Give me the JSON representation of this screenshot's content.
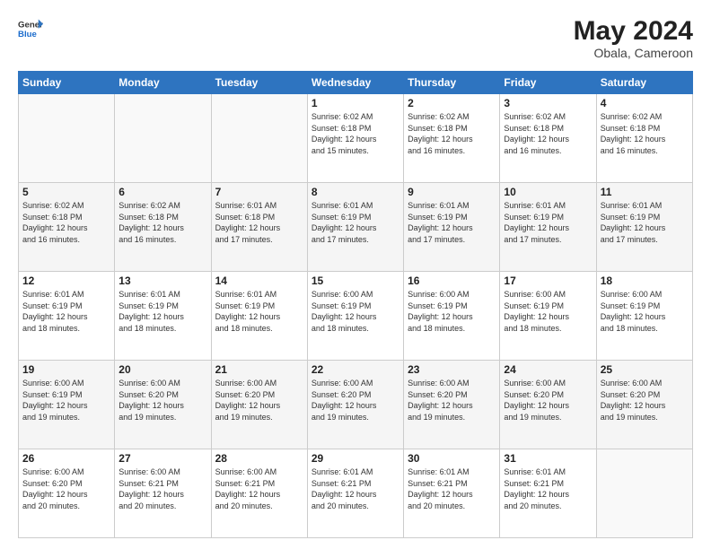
{
  "header": {
    "logo_general": "General",
    "logo_blue": "Blue",
    "month_year": "May 2024",
    "location": "Obala, Cameroon"
  },
  "days_of_week": [
    "Sunday",
    "Monday",
    "Tuesday",
    "Wednesday",
    "Thursday",
    "Friday",
    "Saturday"
  ],
  "weeks": [
    [
      {
        "day": "",
        "info": ""
      },
      {
        "day": "",
        "info": ""
      },
      {
        "day": "",
        "info": ""
      },
      {
        "day": "1",
        "info": "Sunrise: 6:02 AM\nSunset: 6:18 PM\nDaylight: 12 hours\nand 15 minutes."
      },
      {
        "day": "2",
        "info": "Sunrise: 6:02 AM\nSunset: 6:18 PM\nDaylight: 12 hours\nand 16 minutes."
      },
      {
        "day": "3",
        "info": "Sunrise: 6:02 AM\nSunset: 6:18 PM\nDaylight: 12 hours\nand 16 minutes."
      },
      {
        "day": "4",
        "info": "Sunrise: 6:02 AM\nSunset: 6:18 PM\nDaylight: 12 hours\nand 16 minutes."
      }
    ],
    [
      {
        "day": "5",
        "info": "Sunrise: 6:02 AM\nSunset: 6:18 PM\nDaylight: 12 hours\nand 16 minutes."
      },
      {
        "day": "6",
        "info": "Sunrise: 6:02 AM\nSunset: 6:18 PM\nDaylight: 12 hours\nand 16 minutes."
      },
      {
        "day": "7",
        "info": "Sunrise: 6:01 AM\nSunset: 6:18 PM\nDaylight: 12 hours\nand 17 minutes."
      },
      {
        "day": "8",
        "info": "Sunrise: 6:01 AM\nSunset: 6:19 PM\nDaylight: 12 hours\nand 17 minutes."
      },
      {
        "day": "9",
        "info": "Sunrise: 6:01 AM\nSunset: 6:19 PM\nDaylight: 12 hours\nand 17 minutes."
      },
      {
        "day": "10",
        "info": "Sunrise: 6:01 AM\nSunset: 6:19 PM\nDaylight: 12 hours\nand 17 minutes."
      },
      {
        "day": "11",
        "info": "Sunrise: 6:01 AM\nSunset: 6:19 PM\nDaylight: 12 hours\nand 17 minutes."
      }
    ],
    [
      {
        "day": "12",
        "info": "Sunrise: 6:01 AM\nSunset: 6:19 PM\nDaylight: 12 hours\nand 18 minutes."
      },
      {
        "day": "13",
        "info": "Sunrise: 6:01 AM\nSunset: 6:19 PM\nDaylight: 12 hours\nand 18 minutes."
      },
      {
        "day": "14",
        "info": "Sunrise: 6:01 AM\nSunset: 6:19 PM\nDaylight: 12 hours\nand 18 minutes."
      },
      {
        "day": "15",
        "info": "Sunrise: 6:00 AM\nSunset: 6:19 PM\nDaylight: 12 hours\nand 18 minutes."
      },
      {
        "day": "16",
        "info": "Sunrise: 6:00 AM\nSunset: 6:19 PM\nDaylight: 12 hours\nand 18 minutes."
      },
      {
        "day": "17",
        "info": "Sunrise: 6:00 AM\nSunset: 6:19 PM\nDaylight: 12 hours\nand 18 minutes."
      },
      {
        "day": "18",
        "info": "Sunrise: 6:00 AM\nSunset: 6:19 PM\nDaylight: 12 hours\nand 18 minutes."
      }
    ],
    [
      {
        "day": "19",
        "info": "Sunrise: 6:00 AM\nSunset: 6:19 PM\nDaylight: 12 hours\nand 19 minutes."
      },
      {
        "day": "20",
        "info": "Sunrise: 6:00 AM\nSunset: 6:20 PM\nDaylight: 12 hours\nand 19 minutes."
      },
      {
        "day": "21",
        "info": "Sunrise: 6:00 AM\nSunset: 6:20 PM\nDaylight: 12 hours\nand 19 minutes."
      },
      {
        "day": "22",
        "info": "Sunrise: 6:00 AM\nSunset: 6:20 PM\nDaylight: 12 hours\nand 19 minutes."
      },
      {
        "day": "23",
        "info": "Sunrise: 6:00 AM\nSunset: 6:20 PM\nDaylight: 12 hours\nand 19 minutes."
      },
      {
        "day": "24",
        "info": "Sunrise: 6:00 AM\nSunset: 6:20 PM\nDaylight: 12 hours\nand 19 minutes."
      },
      {
        "day": "25",
        "info": "Sunrise: 6:00 AM\nSunset: 6:20 PM\nDaylight: 12 hours\nand 19 minutes."
      }
    ],
    [
      {
        "day": "26",
        "info": "Sunrise: 6:00 AM\nSunset: 6:20 PM\nDaylight: 12 hours\nand 20 minutes."
      },
      {
        "day": "27",
        "info": "Sunrise: 6:00 AM\nSunset: 6:21 PM\nDaylight: 12 hours\nand 20 minutes."
      },
      {
        "day": "28",
        "info": "Sunrise: 6:00 AM\nSunset: 6:21 PM\nDaylight: 12 hours\nand 20 minutes."
      },
      {
        "day": "29",
        "info": "Sunrise: 6:01 AM\nSunset: 6:21 PM\nDaylight: 12 hours\nand 20 minutes."
      },
      {
        "day": "30",
        "info": "Sunrise: 6:01 AM\nSunset: 6:21 PM\nDaylight: 12 hours\nand 20 minutes."
      },
      {
        "day": "31",
        "info": "Sunrise: 6:01 AM\nSunset: 6:21 PM\nDaylight: 12 hours\nand 20 minutes."
      },
      {
        "day": "",
        "info": ""
      }
    ]
  ]
}
